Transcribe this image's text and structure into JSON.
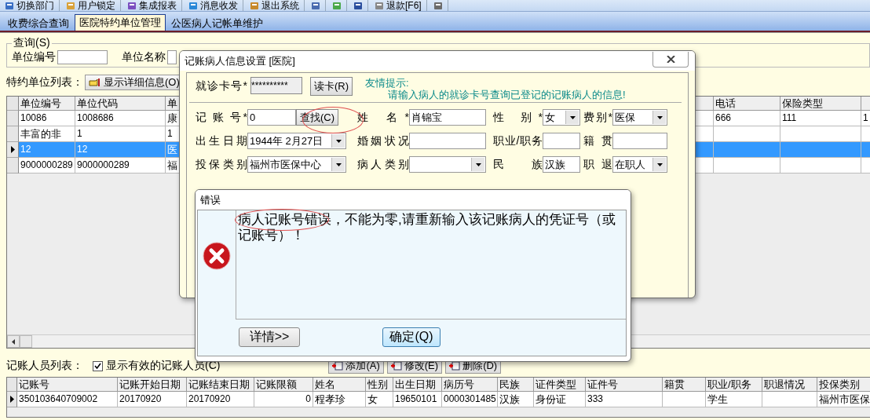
{
  "toolbar": [
    {
      "kind": "button",
      "label": "切换部门"
    },
    {
      "kind": "button",
      "label": "用户锁定"
    },
    {
      "kind": "button",
      "label": "集成报表"
    },
    {
      "kind": "button",
      "label": "消息收发"
    },
    {
      "kind": "button",
      "label": "退出系统"
    },
    {
      "kind": "icon"
    },
    {
      "kind": "icon"
    },
    {
      "kind": "icon"
    },
    {
      "kind": "button",
      "label": "退款[F6]"
    },
    {
      "kind": "icon"
    }
  ],
  "tabs": [
    {
      "label": "收费综合查询",
      "selected": false
    },
    {
      "label": "医院特约单位管理",
      "selected": true
    },
    {
      "label": "公医病人记帐单维护",
      "selected": false
    }
  ],
  "query": {
    "title": "查询(S)",
    "fields": [
      {
        "label": "单位编号"
      },
      {
        "label": "单位名称"
      }
    ]
  },
  "unit_list": {
    "label": "特约单位列表：",
    "detail_button": "显示详细信息(O)",
    "columns": [
      {
        "label": "单位编号"
      },
      {
        "label": "单位代码"
      },
      {
        "label": "单"
      },
      {
        "label": "电话"
      },
      {
        "label": "保险类型"
      },
      {}
    ],
    "rows": [
      {
        "cells": [
          "10086",
          "1008686",
          "康",
          "666",
          "111",
          "1"
        ],
        "current": false,
        "selected": false
      },
      {
        "cells": [
          "丰富的非",
          "1",
          "1"
        ],
        "current": false,
        "selected": false
      },
      {
        "cells": [
          "12",
          "12",
          "医"
        ],
        "current": true,
        "selected": true
      },
      {
        "cells": [
          "9000000289",
          "9000000289",
          "福"
        ],
        "current": false,
        "selected": false
      }
    ]
  },
  "account_list": {
    "label": "记账人员列表：",
    "show_valid": {
      "label": "显示有效的记账人员(C)",
      "checked": true
    },
    "buttons": [
      "添加(A)",
      "修改(E)",
      "删除(D)"
    ],
    "columns": [
      {
        "label": "记账号"
      },
      {
        "label": "记账开始日期"
      },
      {
        "label": "记账结束日期"
      },
      {
        "label": "记账限额",
        "numeric": true
      },
      {
        "label": "姓名"
      },
      {
        "label": "性别"
      },
      {
        "label": "出生日期"
      },
      {
        "label": "病历号"
      },
      {
        "label": "民族"
      },
      {
        "label": "证件类型"
      },
      {
        "label": "证件号"
      },
      {
        "label": "籍贯"
      },
      {
        "label": "职业/职务"
      },
      {
        "label": "职退情况"
      },
      {
        "label": "投保类别"
      }
    ],
    "rows": [
      {
        "cells": [
          "350103640709002",
          "20170920",
          "20170920",
          "0",
          "程孝珍",
          "女",
          "19650101",
          "0000301485",
          "汉族",
          "身份证",
          "333",
          null,
          "学生",
          null,
          "福州市医保"
        ],
        "current": true,
        "selected": false
      }
    ]
  },
  "patient_dialog": {
    "title": "记账病人信息设置 [医院]",
    "card": {
      "label": "就诊卡号*",
      "value": "**********",
      "button": "读卡(R)"
    },
    "tip": {
      "title": "友情提示:",
      "text": "请输入病人的就诊卡号查询已登记的记账病人的信息!"
    },
    "rows": [
      [
        {
          "label": "记 账 号*",
          "kind": "text_button",
          "value": "0",
          "button": "查找(C)"
        },
        {
          "label": "姓 名*",
          "kind": "text",
          "value": "肖锦宝"
        },
        {
          "label": "性 别*",
          "kind": "select",
          "value": "女"
        },
        {
          "label": "费别*",
          "kind": "select",
          "value": "医保"
        }
      ],
      [
        {
          "label": "出生日期",
          "kind": "select",
          "value": "1944年 2月27日"
        },
        {
          "label": "婚姻状况",
          "kind": "text"
        },
        {
          "label": "职业/职务",
          "kind": "text"
        },
        {
          "label": "籍贯",
          "kind": "text"
        }
      ],
      [
        {
          "label": "投保类别",
          "kind": "select",
          "value": "福州市医保中心"
        },
        {
          "label": "病人类别",
          "kind": "select"
        },
        {
          "label": "民 族",
          "kind": "text",
          "value": "汉族"
        },
        {
          "label": "职退",
          "kind": "select",
          "value": "在职人"
        }
      ]
    ]
  },
  "error_dialog": {
    "title": "错误",
    "message": "病人记账号错误，不能为零,请重新输入该记账病人的凭证号（或记账号）！",
    "buttons": [
      {
        "label": "详情>>",
        "focused": false
      },
      {
        "label": "确定(Q)",
        "focused": true
      }
    ]
  }
}
